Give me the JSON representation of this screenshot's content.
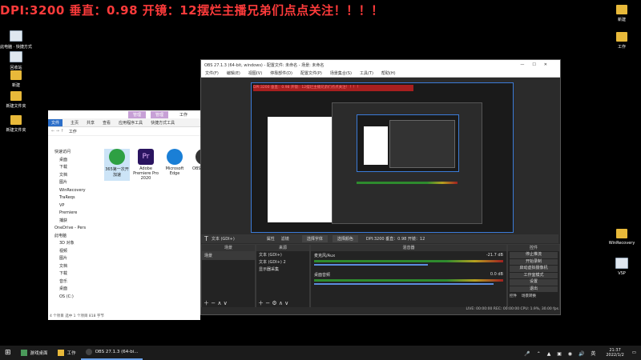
{
  "overlay": {
    "text": "DPI:3200 垂直：0.98 开镜：12摆烂主播兄弟们点点关注！！！！"
  },
  "desktop_icons_left": [
    "此电脑 · 快捷方式",
    "回收站",
    "新建",
    "新建文件夹",
    "新建文件夹"
  ],
  "desktop_icons_right": [
    "新建",
    "工作",
    "WinRecovery",
    "VSP"
  ],
  "explorer": {
    "title": "工作",
    "ribbon_tabs": [
      "文件",
      "主页",
      "共享",
      "查看"
    ],
    "manage1": "管理",
    "manage2": "管理",
    "manage1_sub": "应用程序工具",
    "manage2_sub": "快捷方式工具",
    "path": "工作",
    "quick_access": "快速访问",
    "nav_items": [
      "桌面",
      "下载",
      "文档",
      "图片",
      "WinRecovery",
      "TraReqs",
      "VP",
      "Premiere",
      "捕获",
      "OneDrive - Pers",
      "此电脑",
      "3D 对象",
      "视频",
      "图片",
      "文档",
      "下载",
      "音乐",
      "桌面",
      "OS (C:)"
    ],
    "files": [
      {
        "name": "365第一次开 加速",
        "color": "#2ea043"
      },
      {
        "name": "Adobe Premiere Pro 2020",
        "color": "#2a1460"
      },
      {
        "name": "Microsoft Edge",
        "color": "#1a7fd6"
      },
      {
        "name": "OBS Studio",
        "color": "#333333"
      }
    ],
    "status": "4 个项目   选中 1 个项目  818 字节"
  },
  "obs": {
    "title": "OBS 27.1.3 (64-bit, windows) - 配置文件: 未命名 - 场景: 未命名",
    "menu": [
      "文件(F)",
      "编辑(E)",
      "视图(V)",
      "停靠部件(D)",
      "配置文件(P)",
      "场景集合(S)",
      "工具(T)",
      "帮助(H)"
    ],
    "source_label": "文本 (GDI+)",
    "props_label": "属性",
    "filters_label": "滤镜",
    "font_btn": "选择字体",
    "color_btn": "选择颜色",
    "text_preview": "DPI:3200 垂直：0.98 开镜：12",
    "scenes_header": "场景",
    "scenes": [
      "场景"
    ],
    "sources_header": "来源",
    "sources": [
      "文本 (GDI+)",
      "文本 (GDI+) 2",
      "显示器采集"
    ],
    "mixer_header": "混音器",
    "mixer": [
      {
        "name": "麦克风/Aux",
        "db": "-21.7 dB"
      },
      {
        "name": "桌面音频",
        "db": "0.0 dB"
      }
    ],
    "controls_header": "控件",
    "controls": [
      "停止推流",
      "开始录制",
      "启动虚拟摄像机",
      "工作室模式",
      "设置",
      "退出"
    ],
    "controls_tabs": [
      "控件",
      "场景转换"
    ],
    "status": "LIVE: 00:00:00   REC: 00:00:00   CPU: 1.9%, 30.00 fps"
  },
  "taskbar": {
    "items": [
      "游戏桌面",
      "工作",
      "OBS 27.1.3 (64-bi..."
    ],
    "time": "21:37",
    "date": "2022/1/2"
  }
}
